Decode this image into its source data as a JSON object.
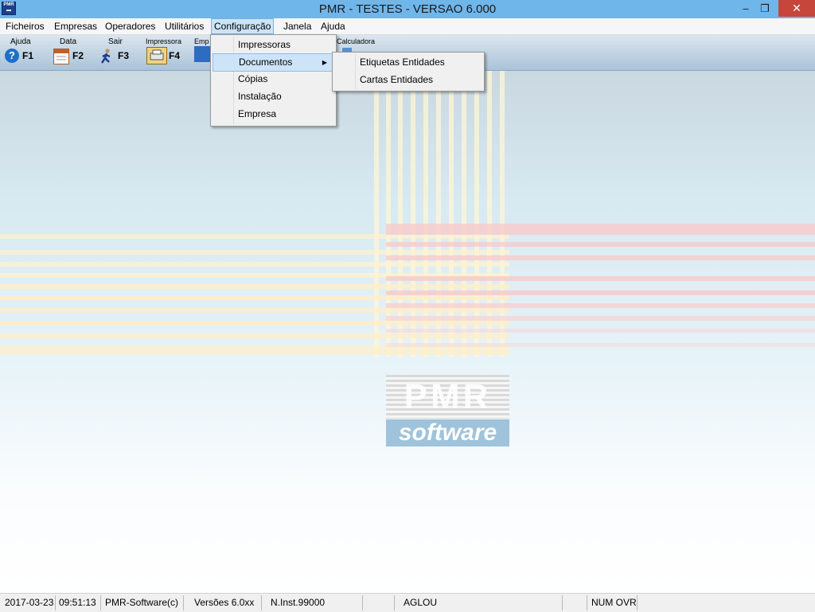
{
  "window": {
    "title": "PMR - TESTES - VERSAO 6.000",
    "minimize": "–",
    "maximize": "❐",
    "close": "✕"
  },
  "menubar": {
    "items": [
      "Ficheiros",
      "Empresas",
      "Operadores",
      "Utilitários",
      "Configuração",
      "Janela",
      "Ajuda"
    ],
    "active": "Configuração"
  },
  "toolbar": {
    "buttons": [
      {
        "label": "Ajuda",
        "key": "F1",
        "icon": "help-icon"
      },
      {
        "label": "Data",
        "key": "F2",
        "icon": "calendar-icon"
      },
      {
        "label": "Sair",
        "key": "F3",
        "icon": "exit-runner-icon"
      },
      {
        "label": "Impressora",
        "key": "F4",
        "icon": "printer-icon"
      },
      {
        "label": "Emp",
        "key": "",
        "icon": "company-icon"
      },
      {
        "label": "Calculadora",
        "key": "",
        "icon": "calculator-icon"
      }
    ]
  },
  "configuracao_menu": {
    "items": [
      "Impressoras",
      "Documentos",
      "Cópias",
      "Instalação",
      "Empresa"
    ],
    "highlighted": "Documentos"
  },
  "documentos_submenu": {
    "items": [
      "Etiquetas Entidades",
      "Cartas Entidades"
    ]
  },
  "logo": {
    "brand": "PMR",
    "tagline": "software"
  },
  "statusbar": {
    "date": "2017-03-23",
    "time": "09:51:13",
    "company": "PMR-Software(c)",
    "version": "Versões 6.0xx",
    "install": "N.Inst.99000",
    "user": "AGLOU",
    "keys": "NUM OVR"
  },
  "colors": {
    "titlebar": "#6fb6ea",
    "close": "#c7463b",
    "menu_highlight": "#cde4f8"
  }
}
